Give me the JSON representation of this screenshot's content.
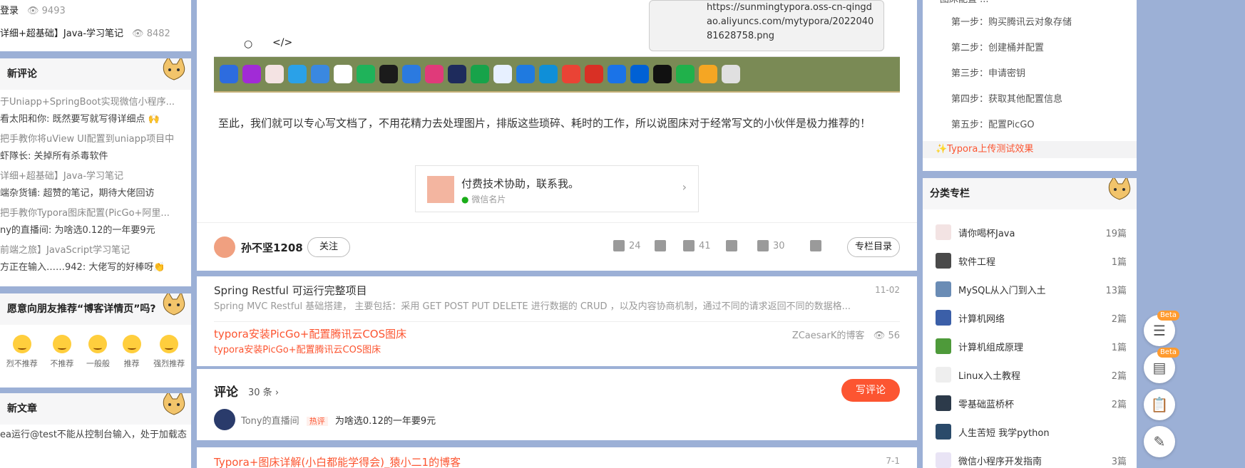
{
  "left": {
    "top_items": [
      {
        "title": "登录",
        "views": "9493"
      },
      {
        "title": "详细+超基础】Java-学习笔记",
        "views": "8482"
      }
    ],
    "comments_title": "新评论",
    "comments": [
      {
        "t": "于Uniapp+SpringBoot实现微信小程序...",
        "c": "看太阳和你: 既然要写就写得详细点 🙌"
      },
      {
        "t": "把手教你将uView UI配置到uniapp项目中",
        "c": "虾隊长: 关掉所有杀毒软件"
      },
      {
        "t": "详细+超基础】Java-学习笔记",
        "c": "端杂货铺: 超赞的笔记，期待大佬回访"
      },
      {
        "t": "把手教你Typora图床配置(PicGo+阿里...",
        "c": "ny的直播间: 为啥选0.12的一年要9元"
      },
      {
        "t": "前端之旅】JavaScript学习笔记",
        "c": "方正在输入……942: 大佬写的好棒呀👏"
      }
    ],
    "recommend_title": "愿意向朋友推荐“博客详情页”吗?",
    "faces": [
      "烈不推荐",
      "不推荐",
      "一般般",
      "推荐",
      "强烈推荐"
    ],
    "latest_title": "新文章",
    "latest_item": "ea运行@test不能从控制台输入，处于加载态"
  },
  "center": {
    "tooltip_url": "https://sunmingtypora.oss-cn-qingdao.aliyuncs.com/mytypora/202204081628758.png",
    "paragraph": "至此，我们就可以专心写文档了，不用花精力去处理图片，排版这些琐碎、耗时的工作，所以说图床对于经常写文的小伙伴是极力推荐的！",
    "card": {
      "title": "付费技术协助，联系我。",
      "sub": "微信名片"
    },
    "author": "孙不坚1208",
    "follow": "关注",
    "likes": "24",
    "stars": "41",
    "comments_count": "30",
    "column_dir": "专栏目录",
    "rec1": {
      "title": "Spring Restful 可运行完整项目",
      "date": "11-02",
      "desc": "Spring MVC Restful 基础搭建， 主要包括：采用 GET POST PUT DELETE 进行数据的 CRUD ，以及内容协商机制，通过不同的请求返回不同的数据格..."
    },
    "rec2": {
      "title": "typora安装PicGo+配置腾讯云COS图床",
      "source": "ZCaesarK的博客",
      "views": "56",
      "desc": "typora安装PicGo+配置腾讯云COS图床"
    },
    "comment_section": {
      "title": "评论",
      "count": "30 条",
      "write": "写评论",
      "user": "Tony的直播间",
      "badge": "热评",
      "text": "为啥选0.12的一年要9元"
    },
    "rec3": {
      "title": "Typora+图床详解(小白都能学得会)_猿小二1的博客",
      "date": "7-1"
    }
  },
  "right": {
    "toc_top": "图床配置 ...",
    "steps": [
      "第一步：购买腾讯云对象存储",
      "第二步：创建桶并配置",
      "第三步：申请密钥",
      "第四步：获取其他配置信息",
      "第五步：配置PicGO"
    ],
    "toc_active": "✨Typora上传测试效果",
    "columns_title": "分类专栏",
    "columns": [
      {
        "name": "请你喝杯Java",
        "count": "19篇"
      },
      {
        "name": "软件工程",
        "count": "1篇"
      },
      {
        "name": "MySQL从入门到入土",
        "count": "13篇"
      },
      {
        "name": "计算机网络",
        "count": "2篇"
      },
      {
        "name": "计算机组成原理",
        "count": "1篇"
      },
      {
        "name": "Linux入土教程",
        "count": "2篇"
      },
      {
        "name": "零基础蓝桥杯",
        "count": "2篇"
      },
      {
        "name": "人生苦短 我学python",
        "count": ""
      },
      {
        "name": "微信小程序开发指南",
        "count": "3篇"
      }
    ],
    "beta": "Beta"
  }
}
